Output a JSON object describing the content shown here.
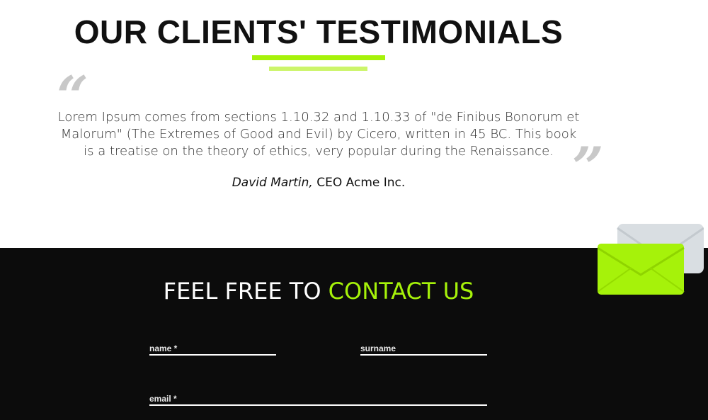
{
  "testimonials": {
    "title": "OUR CLIENTS' TESTIMONIALS",
    "quote_open": "“",
    "quote_close": "”",
    "quote": "Lorem Ipsum comes from sections 1.10.32 and 1.10.33 of \"de Finibus Bonorum et Malorum\" (The Extremes of Good and Evil) by Cicero, written in 45 BC. This book is a treatise on the theory of ethics, very popular during the Renaissance.",
    "author_name": "David Martin,",
    "author_role": " CEO Acme Inc."
  },
  "contact": {
    "title_prefix": "FEEL FREE TO ",
    "title_highlight": "CONTACT US",
    "fields": {
      "name_label": "name *",
      "surname_label": "surname",
      "email_label": "email *"
    }
  },
  "colors": {
    "accent": "#a6f20a",
    "accent_light": "#ccf56a",
    "dark_bg": "#0c0c0c",
    "envelope_back": "#d9dee2"
  },
  "icons": {
    "open_quote": "open-quote-icon",
    "close_quote": "close-quote-icon",
    "envelope": "envelope-icon"
  }
}
